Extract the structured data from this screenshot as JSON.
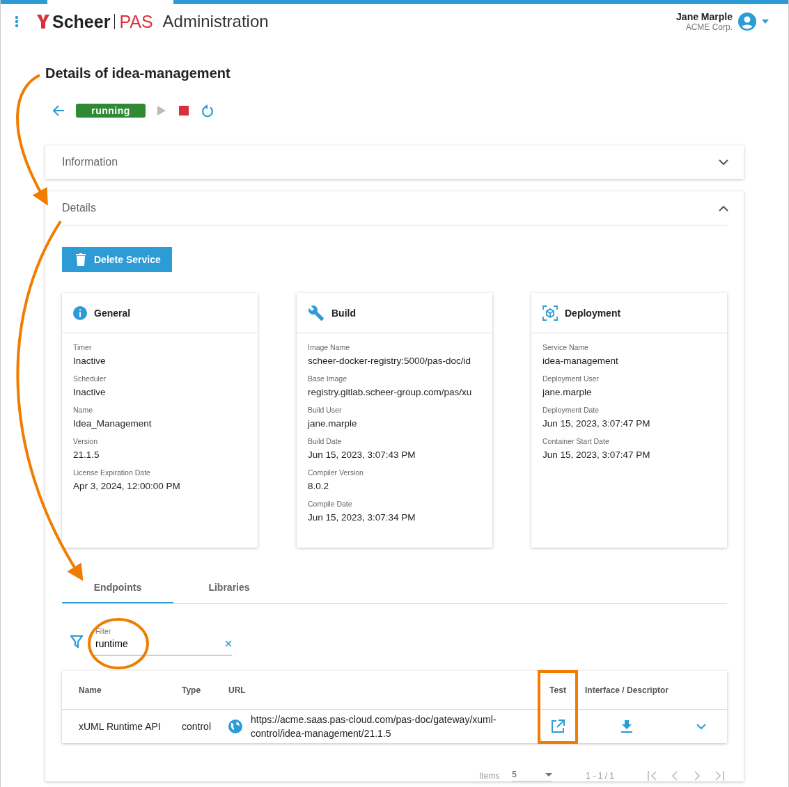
{
  "header": {
    "logo": {
      "brand": "Scheer",
      "product": "PAS"
    },
    "app_title": "Administration",
    "user": {
      "name": "Jane Marple",
      "company": "ACME Corp."
    }
  },
  "page_title": "Details of idea-management",
  "status": {
    "label": "running"
  },
  "actions": [
    {
      "kind": "play",
      "disabled": true
    },
    {
      "kind": "stop",
      "disabled": false
    },
    {
      "kind": "restart",
      "disabled": false
    }
  ],
  "panels": [
    {
      "title": "Information",
      "expanded": false
    },
    {
      "title": "Details",
      "expanded": true
    }
  ],
  "delete_button": "Delete Service",
  "cards": [
    {
      "kind": "info",
      "title": "General",
      "fields": [
        {
          "label": "Timer",
          "value": "Inactive"
        },
        {
          "label": "Scheduler",
          "value": "Inactive"
        },
        {
          "label": "Name",
          "value": "Idea_Management"
        },
        {
          "label": "Version",
          "value": "21.1.5"
        },
        {
          "label": "License Expiration Date",
          "value": "Apr 3, 2024, 12:00:00 PM"
        }
      ]
    },
    {
      "kind": "build",
      "title": "Build",
      "fields": [
        {
          "label": "Image Name",
          "value": "scheer-docker-registry:5000/pas-doc/id"
        },
        {
          "label": "Base Image",
          "value": "registry.gitlab.scheer-group.com/pas/xu"
        },
        {
          "label": "Build User",
          "value": "jane.marple"
        },
        {
          "label": "Build Date",
          "value": "Jun 15, 2023, 3:07:43 PM"
        },
        {
          "label": "Compiler Version",
          "value": "8.0.2"
        },
        {
          "label": "Compile Date",
          "value": "Jun 15, 2023, 3:07:34 PM"
        }
      ]
    },
    {
      "kind": "deployment",
      "title": "Deployment",
      "fields": [
        {
          "label": "Service Name",
          "value": "idea-management"
        },
        {
          "label": "Deployment User",
          "value": "jane.marple"
        },
        {
          "label": "Deployment Date",
          "value": "Jun 15, 2023, 3:07:47 PM"
        },
        {
          "label": "Container Start Date",
          "value": "Jun 15, 2023, 3:07:47 PM"
        }
      ]
    }
  ],
  "tabs": [
    {
      "label": "Endpoints",
      "selected": true
    },
    {
      "label": "Libraries",
      "selected": false
    }
  ],
  "filter": {
    "label": "Filter",
    "value": "runtime"
  },
  "table": {
    "columns": [
      "Name",
      "Type",
      "URL",
      "Test",
      "Interface / Descriptor"
    ],
    "rows": [
      {
        "name": "xUML Runtime API",
        "type": "control",
        "url": "https://acme.saas.pas-cloud.com/pas-doc/gateway/xuml-control/idea-management/21.1.5",
        "expanded": false
      }
    ]
  },
  "pagination": {
    "items_label": "Items",
    "page_size": "5",
    "range": "1 - 1 / 1"
  }
}
